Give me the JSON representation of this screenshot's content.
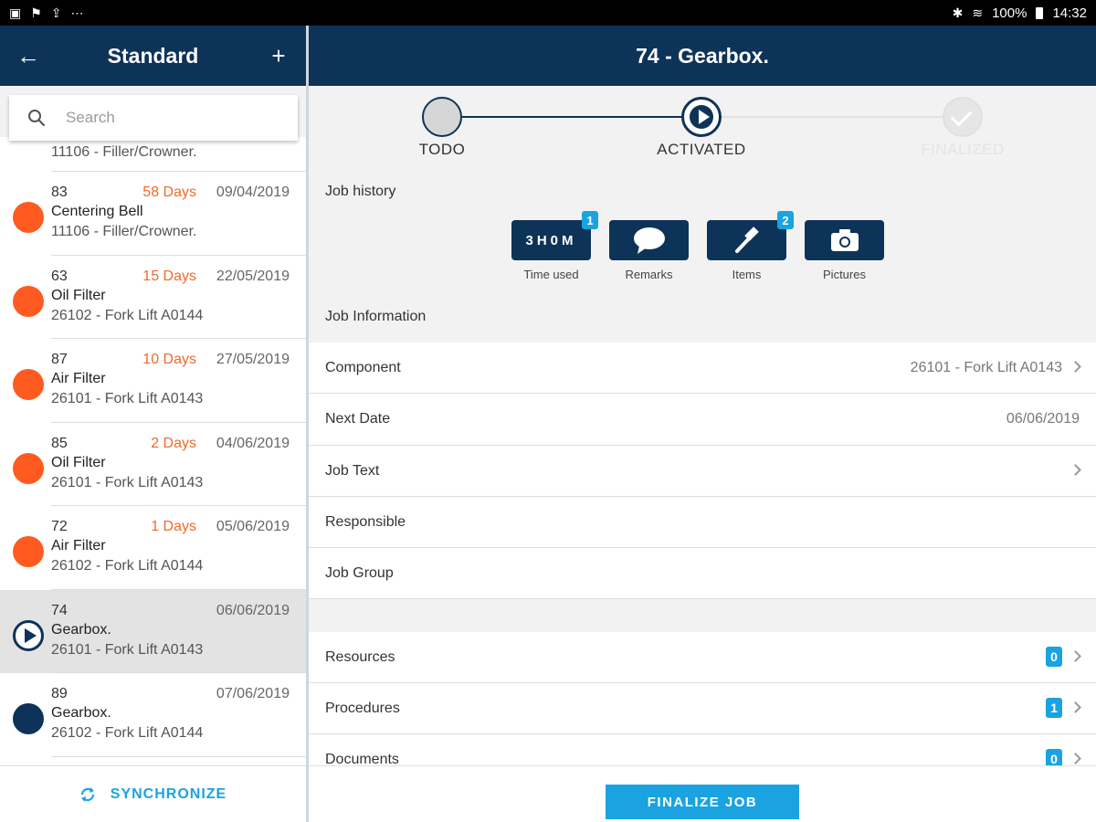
{
  "status_bar": {
    "battery": "100%",
    "time": "14:32"
  },
  "left": {
    "title": "Standard",
    "search_placeholder": "Search",
    "partial_row": "11106 - Filler/Crowner.",
    "jobs": [
      {
        "num": "83",
        "name": "Centering Bell",
        "component": "11106 - Filler/Crowner.",
        "days": "58 Days",
        "date": "09/04/2019",
        "status": "orange"
      },
      {
        "num": "63",
        "name": "Oil Filter",
        "component": "26102 - Fork Lift A0144",
        "days": "15 Days",
        "date": "22/05/2019",
        "status": "orange"
      },
      {
        "num": "87",
        "name": "Air Filter",
        "component": "26101 - Fork Lift A0143",
        "days": "10 Days",
        "date": "27/05/2019",
        "status": "orange"
      },
      {
        "num": "85",
        "name": "Oil Filter",
        "component": "26101 - Fork Lift A0143",
        "days": "2 Days",
        "date": "04/06/2019",
        "status": "orange"
      },
      {
        "num": "72",
        "name": "Air Filter",
        "component": "26102 - Fork Lift A0144",
        "days": "1 Days",
        "date": "05/06/2019",
        "status": "orange"
      },
      {
        "num": "74",
        "name": "Gearbox.",
        "component": "26101 - Fork Lift A0143",
        "days": "",
        "date": "06/06/2019",
        "status": "play"
      },
      {
        "num": "89",
        "name": "Gearbox.",
        "component": "26102 - Fork Lift A0144",
        "days": "",
        "date": "07/06/2019",
        "status": "navy"
      }
    ],
    "sync_label": "SYNCHRONIZE"
  },
  "right": {
    "title": "74 - Gearbox.",
    "steps": [
      "TODO",
      "ACTIVATED",
      "FINALIZED"
    ],
    "job_history_label": "Job history",
    "history": {
      "time_value": "3H0M",
      "time_badge": "1",
      "time_caption": "Time used",
      "remarks_caption": "Remarks",
      "items_badge": "2",
      "items_caption": "Items",
      "pictures_caption": "Pictures"
    },
    "job_info_label": "Job Information",
    "info": {
      "component_label": "Component",
      "component_value": "26101 - Fork Lift A0143",
      "next_date_label": "Next Date",
      "next_date_value": "06/06/2019",
      "job_text_label": "Job Text",
      "responsible_label": "Responsible",
      "job_group_label": "Job Group"
    },
    "resources": {
      "resources_label": "Resources",
      "resources_count": "0",
      "procedures_label": "Procedures",
      "procedures_count": "1",
      "documents_label": "Documents",
      "documents_count": "0"
    },
    "finalize_label": "FINALIZE JOB"
  },
  "colors": {
    "header": "#0e3358",
    "accent": "#1aa3e0",
    "overdue": "#ff5a1f"
  }
}
